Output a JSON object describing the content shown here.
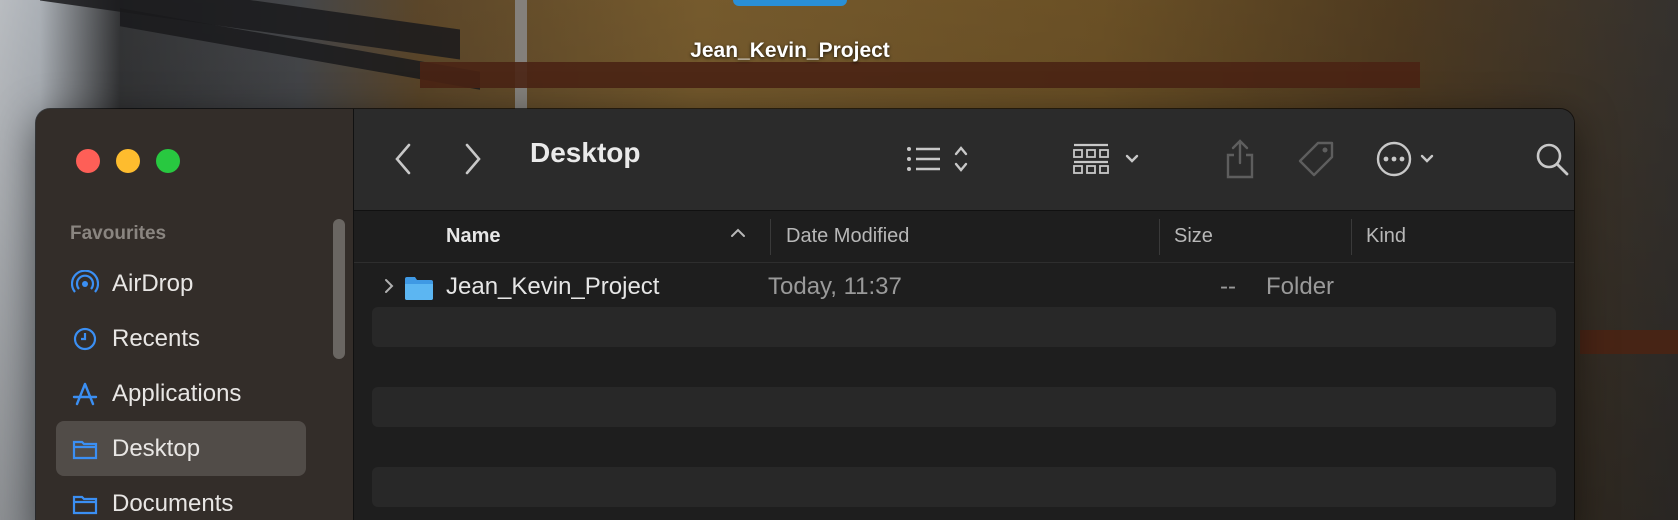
{
  "desktop": {
    "folder_label": "Jean_Kevin_Project"
  },
  "window": {
    "title": "Desktop",
    "sidebar": {
      "section_title": "Favourites",
      "items": [
        {
          "label": "AirDrop",
          "icon": "airdrop-icon"
        },
        {
          "label": "Recents",
          "icon": "clock-icon"
        },
        {
          "label": "Applications",
          "icon": "applications-icon"
        },
        {
          "label": "Desktop",
          "icon": "folder-icon",
          "active": true
        },
        {
          "label": "Documents",
          "icon": "folder-icon"
        }
      ]
    },
    "columns": {
      "name": "Name",
      "date_modified": "Date Modified",
      "size": "Size",
      "kind": "Kind"
    },
    "files": [
      {
        "name": "Jean_Kevin_Project",
        "date_modified": "Today, 11:37",
        "size": "--",
        "kind": "Folder"
      }
    ]
  },
  "colors": {
    "accent": "#3b8ff3",
    "folder_blue": "#56b1f0",
    "traffic_red": "#fe5f57",
    "traffic_yellow": "#febc2e",
    "traffic_green": "#28c840"
  }
}
